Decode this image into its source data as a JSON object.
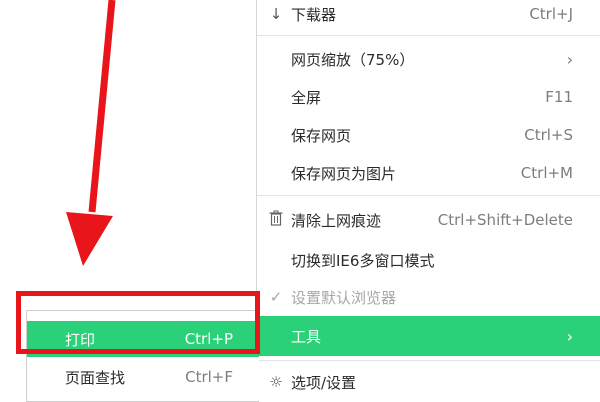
{
  "main_menu": {
    "items": [
      {
        "label": "下载器",
        "shortcut": "Ctrl+J",
        "icon": "download-arrow-icon"
      },
      {
        "label": "网页缩放（75%）",
        "arrow": "›"
      },
      {
        "label": "全屏",
        "shortcut": "F11"
      },
      {
        "label": "保存网页",
        "shortcut": "Ctrl+S"
      },
      {
        "label": "保存网页为图片",
        "shortcut": "Ctrl+M"
      },
      {
        "label": "清除上网痕迹",
        "shortcut": "Ctrl+Shift+Delete",
        "icon": "trash-icon"
      },
      {
        "label": "切换到IE6多窗口模式"
      },
      {
        "label": "设置默认浏览器",
        "icon": "checkmark-icon",
        "disabled": true
      },
      {
        "label": "工具",
        "arrow": "›",
        "active": true
      },
      {
        "label": "选项/设置",
        "icon": "gear-icon"
      }
    ]
  },
  "sub_menu": {
    "items": [
      {
        "label": "打印",
        "shortcut": "Ctrl+P",
        "active": true
      },
      {
        "label": "页面查找",
        "shortcut": "Ctrl+F"
      }
    ]
  },
  "colors": {
    "accent_green": "#2bd178",
    "annotation_red": "#e8161b"
  }
}
